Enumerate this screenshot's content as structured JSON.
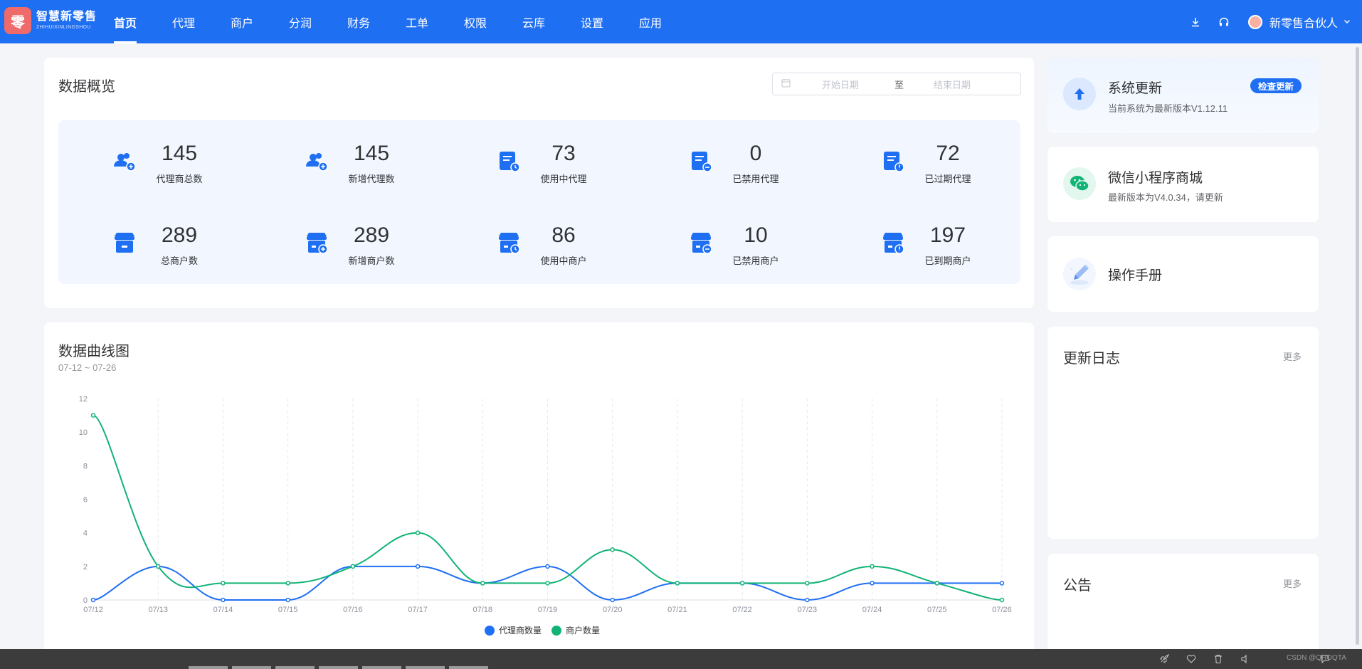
{
  "brand": {
    "name_cn": "智慧新零售",
    "name_en": "ZHIHUIXINLINGSHOU",
    "logo_char": "零"
  },
  "nav": [
    {
      "label": "首页",
      "active": true
    },
    {
      "label": "代理"
    },
    {
      "label": "商户"
    },
    {
      "label": "分润"
    },
    {
      "label": "财务"
    },
    {
      "label": "工单"
    },
    {
      "label": "权限"
    },
    {
      "label": "云库"
    },
    {
      "label": "设置"
    },
    {
      "label": "应用"
    }
  ],
  "user": {
    "name": "新零售合伙人"
  },
  "overview": {
    "title": "数据概览",
    "date_start_placeholder": "开始日期",
    "date_sep": "至",
    "date_end_placeholder": "结束日期",
    "stats": [
      {
        "value": "145",
        "label": "代理商总数",
        "icon": "agents-icon"
      },
      {
        "value": "145",
        "label": "新增代理数",
        "icon": "new-agents-icon"
      },
      {
        "value": "73",
        "label": "使用中代理",
        "icon": "active-agent-doc-icon"
      },
      {
        "value": "0",
        "label": "已禁用代理",
        "icon": "disabled-agent-doc-icon"
      },
      {
        "value": "72",
        "label": "已过期代理",
        "icon": "expired-agent-doc-icon"
      },
      {
        "value": "289",
        "label": "总商户数",
        "icon": "store-icon"
      },
      {
        "value": "289",
        "label": "新增商户数",
        "icon": "new-store-icon"
      },
      {
        "value": "86",
        "label": "使用中商户",
        "icon": "active-store-icon"
      },
      {
        "value": "10",
        "label": "已禁用商户",
        "icon": "disabled-store-icon"
      },
      {
        "value": "197",
        "label": "已到期商户",
        "icon": "expired-store-icon"
      }
    ]
  },
  "chart": {
    "title": "数据曲线图",
    "range": "07-12 ~ 07-26"
  },
  "chart_data": {
    "type": "line",
    "x": [
      "07/12",
      "07/13",
      "07/14",
      "07/15",
      "07/16",
      "07/17",
      "07/18",
      "07/19",
      "07/20",
      "07/21",
      "07/22",
      "07/23",
      "07/24",
      "07/25",
      "07/26"
    ],
    "ylim": [
      0,
      12
    ],
    "yticks": [
      0,
      2,
      4,
      6,
      8,
      10,
      12
    ],
    "grid": "vertical-dashed",
    "legend": "bottom-center",
    "series": [
      {
        "name": "代理商数量",
        "color": "#1f6ff2",
        "values": [
          0,
          2,
          0,
          0,
          2,
          2,
          1,
          2,
          0,
          1,
          1,
          0,
          1,
          1,
          1
        ]
      },
      {
        "name": "商户数量",
        "color": "#12b375",
        "values": [
          11,
          2,
          1,
          1,
          2,
          4,
          1,
          1,
          3,
          1,
          1,
          1,
          2,
          1,
          0
        ]
      }
    ]
  },
  "panels": {
    "update": {
      "title": "系统更新",
      "subtitle": "当前系统为最新版本V1.12.11",
      "button": "检查更新"
    },
    "wechat": {
      "title": "微信小程序商城",
      "subtitle": "最新版本为V4.0.34，请更新"
    },
    "manual": {
      "title": "操作手册"
    },
    "changelog": {
      "title": "更新日志",
      "more": "更多"
    },
    "notice": {
      "title": "公告",
      "more": "更多"
    }
  },
  "taskbar": {
    "watermark": "CSDN @QHOQTA"
  }
}
